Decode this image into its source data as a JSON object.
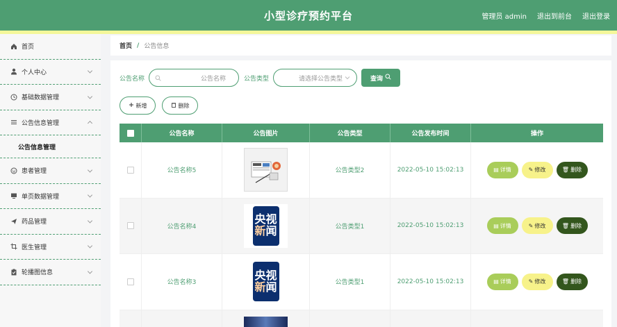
{
  "header": {
    "title": "小型诊疗预约平台",
    "user": "管理员 admin",
    "front_link": "退出到前台",
    "logout_link": "退出登录"
  },
  "sidebar": {
    "items": [
      {
        "label": "首页",
        "icon": "home-icon"
      },
      {
        "label": "个人中心",
        "icon": "user-icon"
      },
      {
        "label": "基础数据管理",
        "icon": "clock-icon"
      },
      {
        "label": "公告信息管理",
        "icon": "list-icon"
      },
      {
        "label": "患者管理",
        "icon": "smiley-icon"
      },
      {
        "label": "单页数据管理",
        "icon": "monitor-icon"
      },
      {
        "label": "药品管理",
        "icon": "send-icon"
      },
      {
        "label": "医生管理",
        "icon": "crop-icon"
      },
      {
        "label": "轮播图信息",
        "icon": "clipboard-icon"
      }
    ],
    "submenu": "公告信息管理"
  },
  "breadcrumb": {
    "home": "首页",
    "sep": "/",
    "current": "公告信息"
  },
  "search": {
    "name_label": "公告名称",
    "name_placeholder": "公告名称",
    "type_label": "公告类型",
    "type_placeholder": "请选择公告类型",
    "button": "查询"
  },
  "actions": {
    "add": "新增",
    "delete": "删除"
  },
  "table": {
    "columns": [
      "公告名称",
      "公告图片",
      "公告类型",
      "公告发布时间",
      "操作"
    ],
    "rows": [
      {
        "name": "公告名称5",
        "image": "news-illustration",
        "type": "公告类型2",
        "time": "2022-05-10 15:02:13"
      },
      {
        "name": "公告名称4",
        "image": "cctv-news-logo",
        "type": "公告类型1",
        "time": "2022-05-10 15:02:13"
      },
      {
        "name": "公告名称3",
        "image": "cctv-news-logo",
        "type": "公告类型1",
        "time": "2022-05-10 15:02:13"
      }
    ],
    "ops": {
      "detail": "详情",
      "edit": "修改",
      "delete": "删除"
    },
    "cctv_text": [
      "央",
      "视",
      "新",
      "闻"
    ]
  },
  "colors": {
    "primary": "#4e9e72",
    "accent": "#f4f79a",
    "detail": "#a9cd5a",
    "edit": "#f7f28a",
    "danger": "#33561d"
  }
}
